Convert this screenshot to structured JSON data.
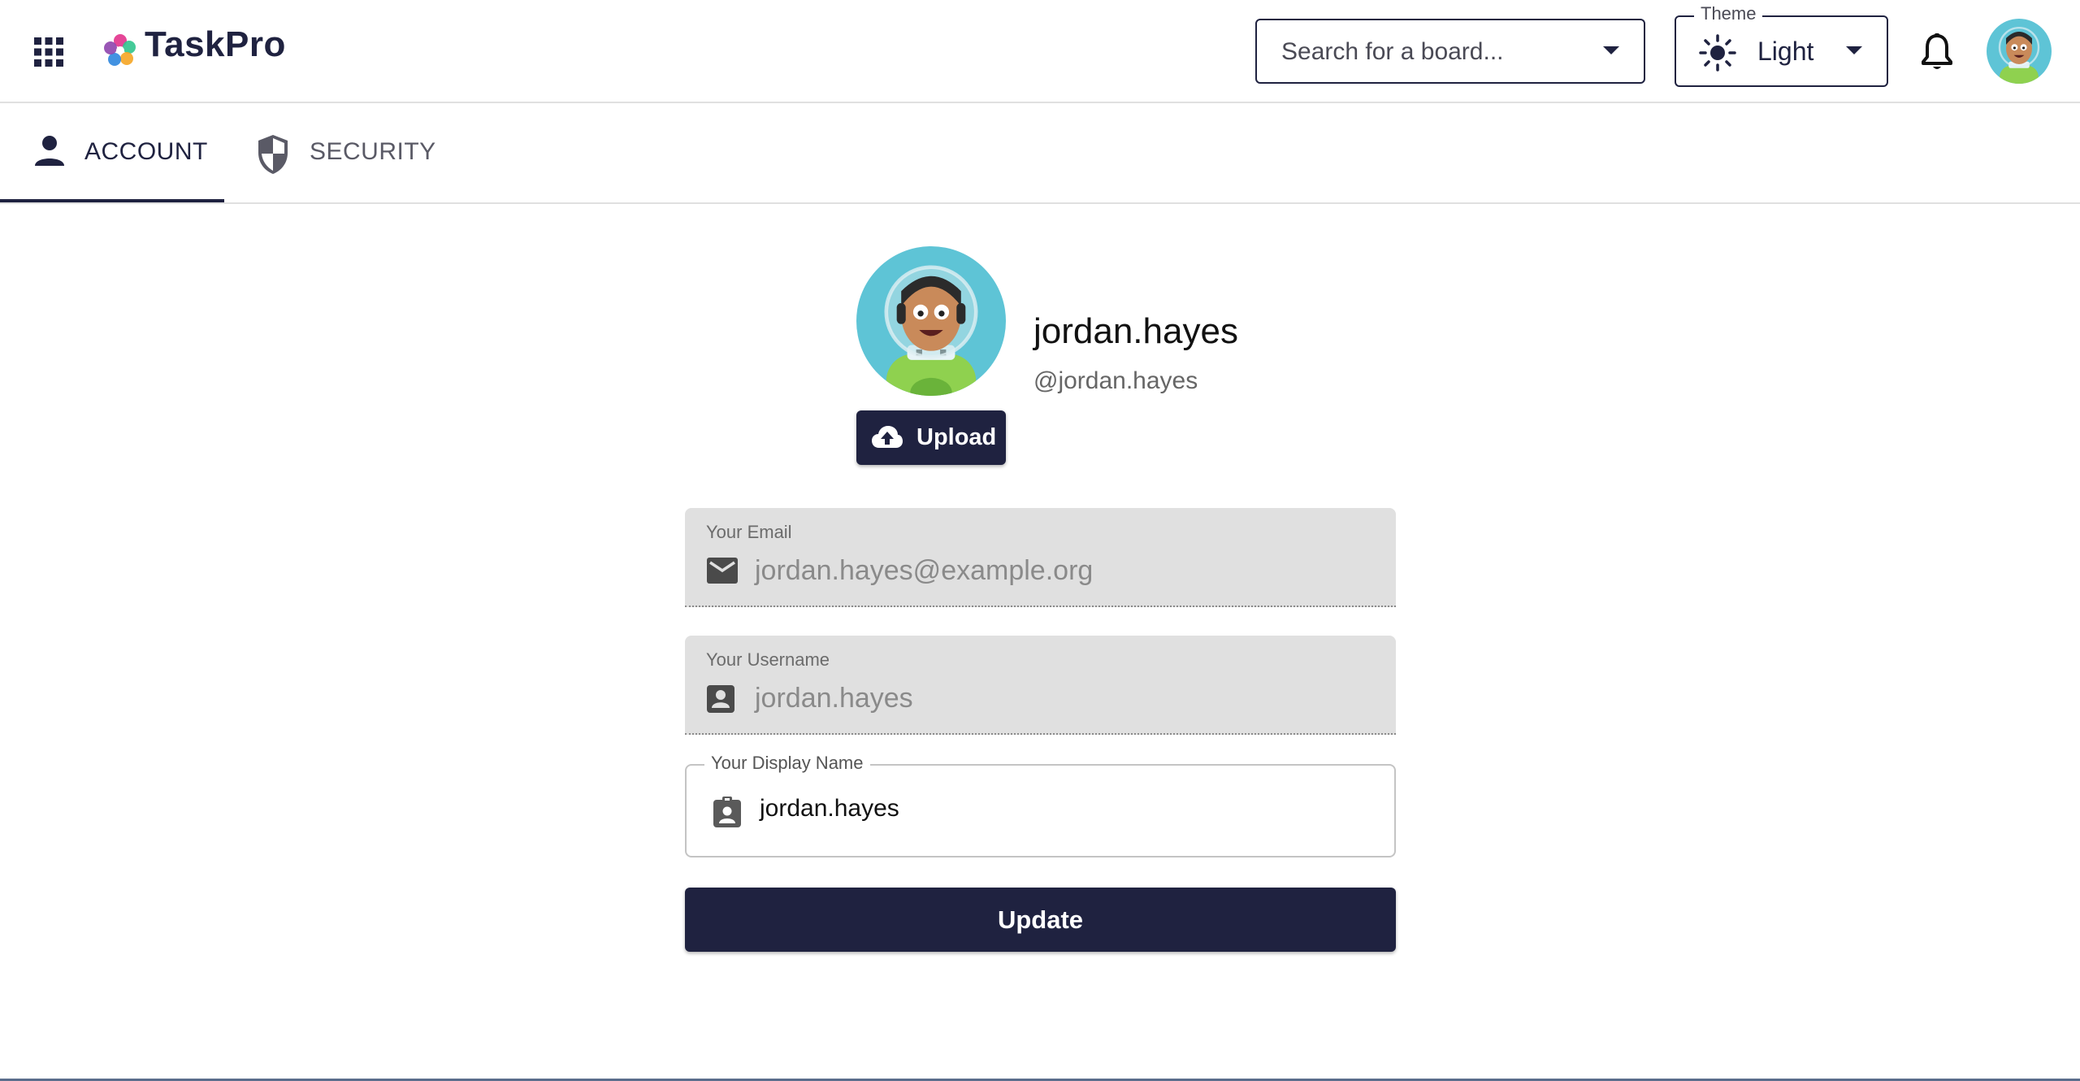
{
  "header": {
    "app_name": "TaskPro",
    "board_search_placeholder": "Search for a board...",
    "theme_label": "Theme",
    "theme_value": "Light"
  },
  "tabs": [
    {
      "label": "ACCOUNT",
      "active": true,
      "icon": "person-icon"
    },
    {
      "label": "SECURITY",
      "active": false,
      "icon": "shield-icon"
    }
  ],
  "profile": {
    "display_name": "jordan.hayes",
    "handle": "@jordan.hayes",
    "upload_label": "Upload"
  },
  "form": {
    "email_label": "Your Email",
    "email_value": "jordan.hayes@example.org",
    "username_label": "Your Username",
    "username_value": "jordan.hayes",
    "display_name_label": "Your Display Name",
    "display_name_value": "jordan.hayes",
    "update_label": "Update"
  },
  "colors": {
    "primary": "#1f2240",
    "avatar_bg": "#5ec4d6",
    "disabled_field_bg": "#e0e0e0"
  }
}
